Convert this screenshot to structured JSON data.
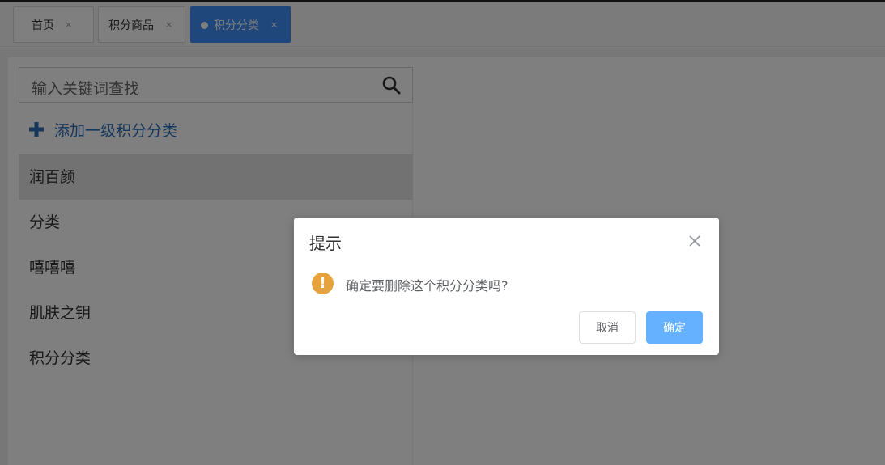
{
  "tabs": [
    {
      "label": "首页",
      "close": "×"
    },
    {
      "label": "积分商品",
      "close": "×"
    },
    {
      "label": "积分分类",
      "close": "×",
      "active": true
    }
  ],
  "search": {
    "placeholder": "输入关键词查找"
  },
  "tree": {
    "add_label": "添加一级积分分类",
    "items": [
      {
        "label": "润百颜",
        "selected": true
      },
      {
        "label": "分类"
      },
      {
        "label": "嘻嘻嘻"
      },
      {
        "label": "肌肤之钥"
      },
      {
        "label": "积分分类"
      }
    ]
  },
  "dialog": {
    "title": "提示",
    "message": "确定要删除这个积分分类吗?",
    "warn_glyph": "!",
    "cancel_label": "取消",
    "confirm_label": "确定"
  },
  "colors": {
    "accent": "#3e8ef7",
    "warning": "#e6a23c",
    "confirm_button": "#66b1ff",
    "add_link": "#2d6fb8"
  }
}
